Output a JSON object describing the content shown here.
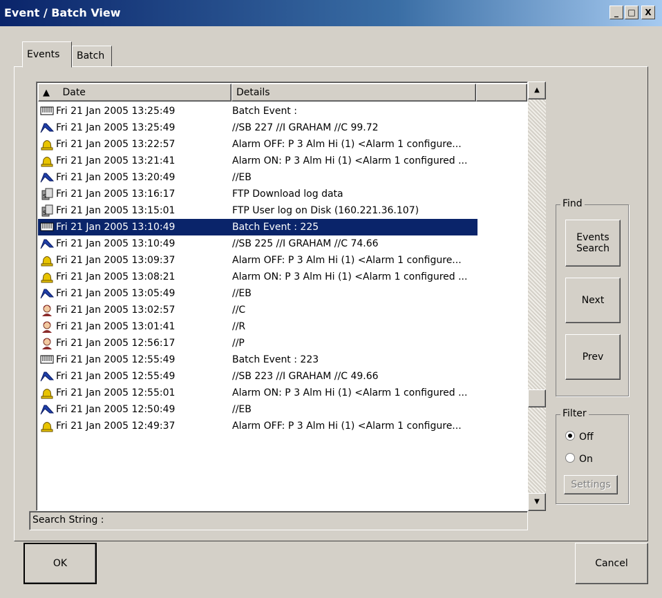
{
  "window": {
    "title": "Event / Batch View",
    "minimize": "_",
    "maximize": "□",
    "close": "X"
  },
  "tabs": [
    {
      "label": "Events",
      "active": true
    },
    {
      "label": "Batch",
      "active": false
    }
  ],
  "list": {
    "columns": [
      "Date",
      "Details"
    ],
    "sort_indicator": "▲",
    "rows": [
      {
        "icon": "batch-icon",
        "date": "Fri 21 Jan 2005 13:25:49",
        "details": "Batch Event :"
      },
      {
        "icon": "pen-icon",
        "date": "Fri 21 Jan 2005 13:25:49",
        "details": "//SB 227 //I GRAHAM //C 99.72"
      },
      {
        "icon": "alarm-bell-icon",
        "date": "Fri 21 Jan 2005 13:22:57",
        "details": "Alarm OFF: P 3 Alm Hi (1) <Alarm 1 configure..."
      },
      {
        "icon": "alarm-bell-icon",
        "date": "Fri 21 Jan 2005 13:21:41",
        "details": "Alarm ON: P 3 Alm Hi (1) <Alarm 1 configured ..."
      },
      {
        "icon": "pen-icon",
        "date": "Fri 21 Jan 2005 13:20:49",
        "details": "//EB"
      },
      {
        "icon": "ftp-icon",
        "date": "Fri 21 Jan 2005 13:16:17",
        "details": "FTP Download log data"
      },
      {
        "icon": "ftp-icon",
        "date": "Fri 21 Jan 2005 13:15:01",
        "details": "FTP User log on Disk (160.221.36.107)"
      },
      {
        "icon": "batch-icon",
        "date": "Fri 21 Jan 2005 13:10:49",
        "details": "Batch Event : 225",
        "selected": true
      },
      {
        "icon": "pen-icon",
        "date": "Fri 21 Jan 2005 13:10:49",
        "details": "//SB 225 //I GRAHAM //C 74.66"
      },
      {
        "icon": "alarm-bell-icon",
        "date": "Fri 21 Jan 2005 13:09:37",
        "details": "Alarm OFF: P 3 Alm Hi (1) <Alarm 1 configure..."
      },
      {
        "icon": "alarm-bell-icon",
        "date": "Fri 21 Jan 2005 13:08:21",
        "details": "Alarm ON: P 3 Alm Hi (1) <Alarm 1 configured ..."
      },
      {
        "icon": "pen-icon",
        "date": "Fri 21 Jan 2005 13:05:49",
        "details": "//EB"
      },
      {
        "icon": "user-icon",
        "date": "Fri 21 Jan 2005 13:02:57",
        "details": "//C"
      },
      {
        "icon": "user-icon",
        "date": "Fri 21 Jan 2005 13:01:41",
        "details": "//R"
      },
      {
        "icon": "user-icon",
        "date": "Fri 21 Jan 2005 12:56:17",
        "details": "//P"
      },
      {
        "icon": "batch-icon",
        "date": "Fri 21 Jan 2005 12:55:49",
        "details": "Batch Event : 223"
      },
      {
        "icon": "pen-icon",
        "date": "Fri 21 Jan 2005 12:55:49",
        "details": "//SB 223 //I GRAHAM //C 49.66"
      },
      {
        "icon": "alarm-bell-icon",
        "date": "Fri 21 Jan 2005 12:55:01",
        "details": "Alarm ON: P 3 Alm Hi (1) <Alarm 1 configured ..."
      },
      {
        "icon": "pen-icon",
        "date": "Fri 21 Jan 2005 12:50:49",
        "details": "//EB"
      },
      {
        "icon": "alarm-bell-icon",
        "date": "Fri 21 Jan 2005 12:49:37",
        "details": "Alarm OFF: P 3 Alm Hi (1) <Alarm 1 configure..."
      }
    ]
  },
  "status": {
    "label": "Search String :"
  },
  "find": {
    "legend": "Find",
    "events_search_line1": "Events",
    "events_search_line2": "Search",
    "next": "Next",
    "prev": "Prev"
  },
  "filter": {
    "legend": "Filter",
    "off_label": "Off",
    "on_label": "On",
    "selected": "Off",
    "settings": "Settings"
  },
  "footer": {
    "ok": "OK",
    "cancel": "Cancel"
  },
  "colors": {
    "selection": "#0a246a",
    "face": "#d4d0c8",
    "pen": "#1f3fa8",
    "bell": "#e8c400"
  }
}
